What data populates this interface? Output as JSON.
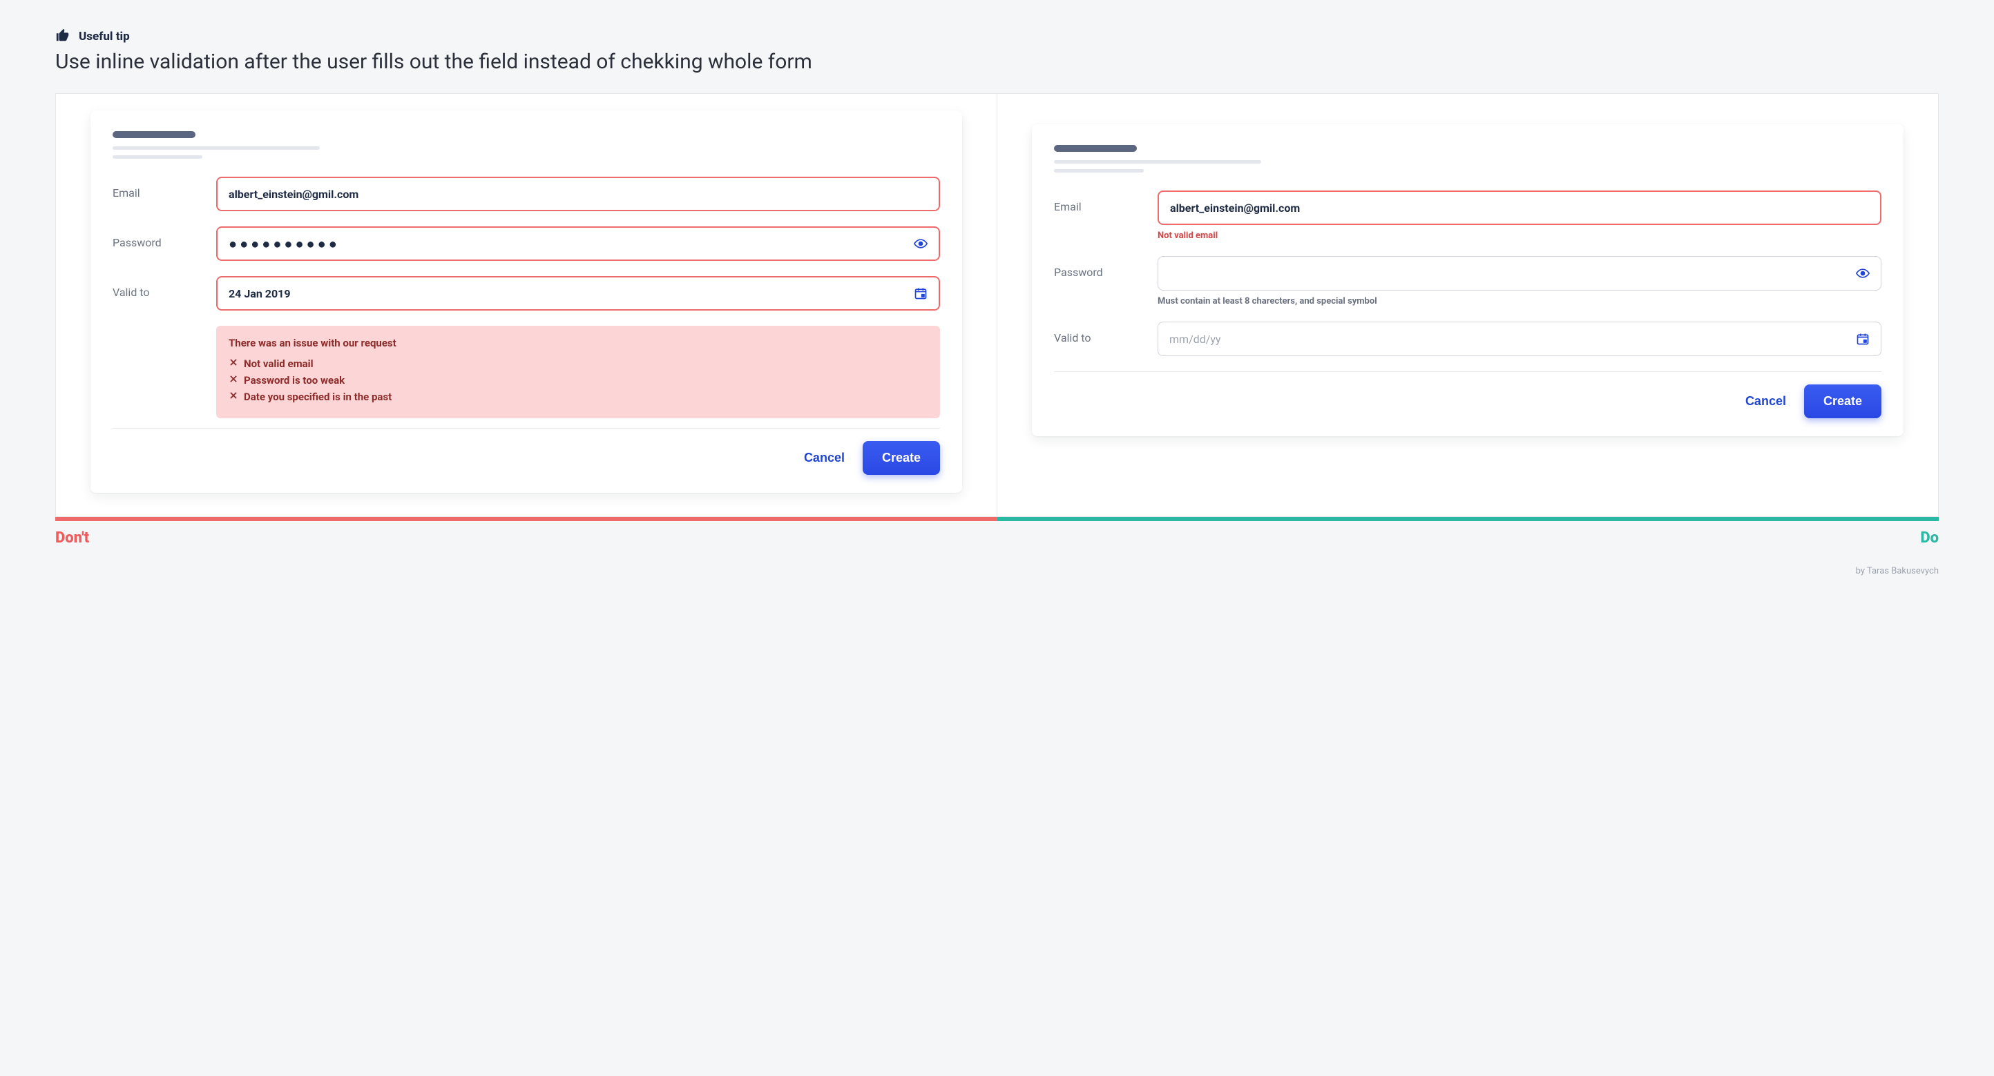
{
  "tip": {
    "label": "Useful tip",
    "text": "Use inline validation after the user fills out the field instead of chekking whole form"
  },
  "labels": {
    "dont": "Don't",
    "do": "Do"
  },
  "form": {
    "email_label": "Email",
    "password_label": "Password",
    "valid_to_label": "Valid to",
    "cancel_label": "Cancel",
    "create_label": "Create"
  },
  "dont": {
    "email_value": "albert_einstein@gmil.com",
    "password_masked": "●●●●●●●●●●",
    "valid_to_value": "24 Jan 2019",
    "error_title": "There was an issue with our request",
    "errors": {
      "0": "Not valid email",
      "1": "Password is too weak",
      "2": "Date you specified is in the past"
    }
  },
  "do": {
    "email_value": "albert_einstein@gmil.com",
    "email_error": "Not valid email",
    "password_hint": "Must contain at least 8 charecters, and special symbol",
    "valid_to_placeholder": "mm/dd/yy"
  },
  "credit": "by Taras Bakusevych"
}
